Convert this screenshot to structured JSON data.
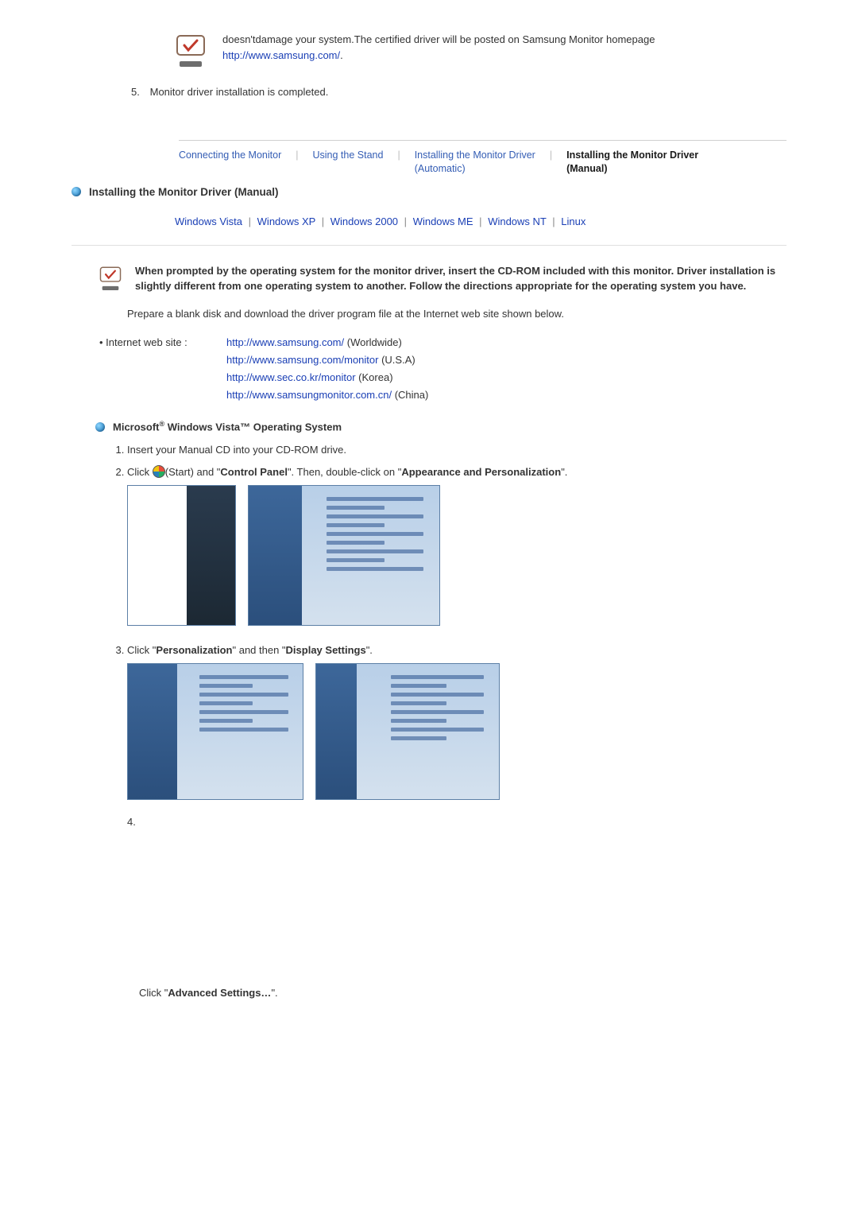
{
  "top": {
    "text": "doesn'tdamage your system.The certified driver will be posted on Samsung Monitor homepage",
    "url": "http://www.samsung.com/",
    "dot": "."
  },
  "step5": {
    "num": "5.",
    "text": "Monitor driver installation is completed."
  },
  "tabs": {
    "t1": "Connecting  the Monitor",
    "t2": "Using the Stand",
    "t3": "Installing the Monitor Driver\n(Automatic)",
    "t4": "Installing the Monitor Driver\n(Manual)"
  },
  "heading1": "Installing the Monitor Driver (Manual)",
  "oslinks": {
    "vista": "Windows Vista",
    "xp": "Windows XP",
    "w2000": "Windows 2000",
    "me": "Windows ME",
    "nt": "Windows NT",
    "linux": "Linux"
  },
  "prompt": "When prompted by the operating system for the monitor driver, insert the CD-ROM included with this monitor. Driver installation is slightly different from one operating system to another. Follow the directions appropriate for the operating system you have.",
  "prepare": "Prepare a blank disk and download the driver program file at the Internet web site shown below.",
  "web": {
    "label": "Internet web site :",
    "rows": [
      {
        "url": "http://www.samsung.com/",
        "suffix": " (Worldwide)"
      },
      {
        "url": "http://www.samsung.com/monitor",
        "suffix": " (U.S.A)"
      },
      {
        "url": "http://www.sec.co.kr/monitor",
        "suffix": " (Korea)"
      },
      {
        "url": "http://www.samsungmonitor.com.cn/",
        "suffix": " (China)"
      }
    ]
  },
  "heading2_pre": "Microsoft",
  "heading2_mid": " Windows Vista™ Operating System",
  "steps": {
    "s1": "Insert your Manual CD into your CD-ROM drive.",
    "s2a": "Click ",
    "s2b": "(Start) and \"",
    "s2c": "Control Panel",
    "s2d": "\". Then, double-click on \"",
    "s2e": "Appearance and Personalization",
    "s2f": "\".",
    "s3a": "Click \"",
    "s3b": "Personalization",
    "s3c": "\" and then \"",
    "s3d": "Display Settings",
    "s3e": "\".",
    "s4a": "Click \"",
    "s4b": "Advanced Settings…",
    "s4c": "\"."
  },
  "num4": "4."
}
